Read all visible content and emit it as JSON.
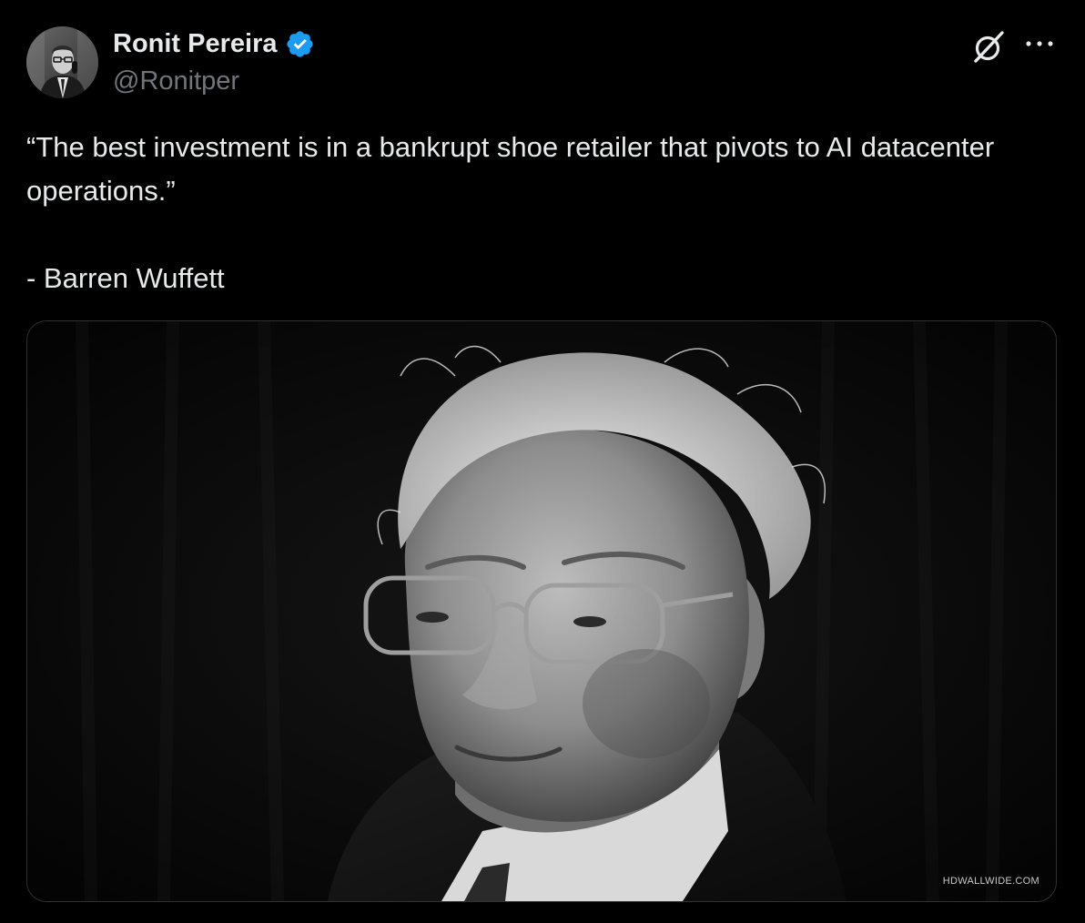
{
  "post": {
    "author": {
      "display_name": "Ronit Pereira",
      "handle": "@Ronitper",
      "verified": true,
      "verified_icon": "verified-badge-icon",
      "verified_color": "#1d9bf0"
    },
    "header_actions": {
      "grok_icon": "grok-icon",
      "more_icon": "more-horizontal-icon"
    },
    "text": {
      "quote": "“The best investment is in a bankrupt shoe retailer that pivots to AI datacenter operations.”",
      "attribution": "- Barren Wuffett"
    },
    "media": {
      "watermark": "HDWALLWIDE.COM"
    }
  },
  "colors": {
    "background": "#000000",
    "primary_text": "#e7e9ea",
    "secondary_text": "#71767b",
    "border": "#2f3336"
  }
}
